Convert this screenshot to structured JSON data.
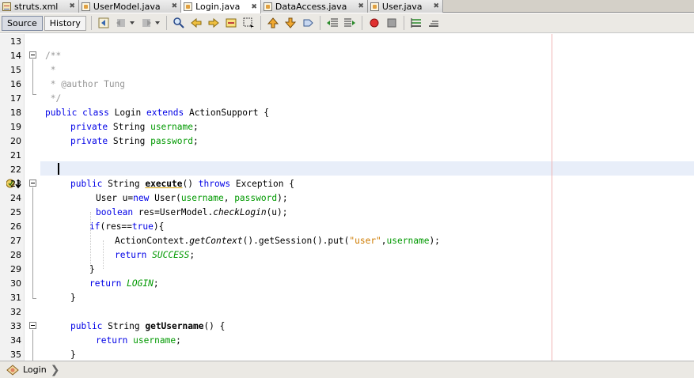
{
  "tabs": [
    {
      "label": "struts.xml",
      "icon": "xml-file-icon",
      "active": false
    },
    {
      "label": "UserModel.java",
      "icon": "java-file-icon",
      "active": false
    },
    {
      "label": "Login.java",
      "icon": "java-file-icon",
      "active": true
    },
    {
      "label": "DataAccess.java",
      "icon": "java-file-icon",
      "active": false
    },
    {
      "label": "User.java",
      "icon": "java-file-icon",
      "active": false
    }
  ],
  "toolbar": {
    "source_label": "Source",
    "history_label": "History"
  },
  "editor": {
    "line_numbers": [
      "13",
      "14",
      "15",
      "16",
      "17",
      "18",
      "19",
      "20",
      "21",
      "22",
      "23",
      "24",
      "25",
      "26",
      "27",
      "28",
      "29",
      "30",
      "31",
      "32",
      "33",
      "34",
      "35"
    ],
    "lines": {
      "l14": "/**",
      "l15": " *",
      "l16": " * @author Tung",
      "l17": " */",
      "l18_kw1": "public",
      "l18_kw2": "class",
      "l18_name": "Login",
      "l18_kw3": "extends",
      "l18_rest": "ActionSupport {",
      "l19_kw": "private",
      "l19_type": "String",
      "l19_field": "username",
      "l20_kw": "private",
      "l20_type": "String",
      "l20_field": "password",
      "l23_kw": "public",
      "l23_type": "String",
      "l23_method": "execute",
      "l23_parens": "()",
      "l23_throws": "throws",
      "l23_rest": "Exception {",
      "l24_a": "User u=",
      "l24_new": "new",
      "l24_b": "User(",
      "l24_f1": "username",
      "l24_c": ", ",
      "l24_f2": "password",
      "l24_d": ");",
      "l25_kw": "boolean",
      "l25_a": "res=UserModel.",
      "l25_m": "checkLogin",
      "l25_b": "(u);",
      "l26_kw": "if",
      "l26_a": "(res==",
      "l26_true": "true",
      "l26_b": "){",
      "l27_a": "ActionContext.",
      "l27_m": "getContext",
      "l27_b": "().getSession().put(",
      "l27_str": "\"user\"",
      "l27_c": ",",
      "l27_f": "username",
      "l27_d": ");",
      "l28_kw": "return",
      "l28_const": "SUCCESS",
      "l28_semi": ";",
      "l29": "}",
      "l30_kw": "return",
      "l30_const": "LOGIN",
      "l30_semi": ";",
      "l31": "}",
      "l33_kw": "public",
      "l33_type": "String",
      "l33_method": "getUsername",
      "l33_rest": "() {",
      "l34_kw": "return",
      "l34_field": "username",
      "l34_semi": ";",
      "l35": "}"
    }
  },
  "navigator": {
    "breadcrumb": "Login"
  },
  "colors": {
    "keyword": "#0000e6",
    "comment": "#969696",
    "field": "#009900",
    "string": "#ce7b00",
    "current_line": "#e8eef9",
    "right_margin": "#f0b4b4"
  }
}
